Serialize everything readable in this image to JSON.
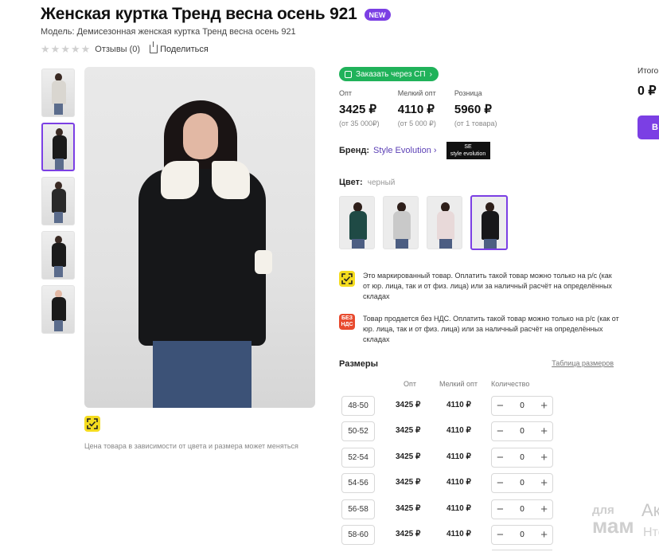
{
  "product": {
    "title": "Женская куртка Тренд весна осень 921",
    "badge": "NEW",
    "model": "Модель: Демисезонная женская куртка Тренд весна осень 921",
    "reviews": "Отзывы (0)",
    "share": "Поделиться",
    "rating_stars": 0,
    "rating_max": 5
  },
  "gallery": {
    "marked_note": "Цена товара в зависимости от цвета и размера может меняться"
  },
  "sp_button": "Заказать через СП",
  "prices": [
    {
      "label": "Опт",
      "value": "3425 ₽",
      "sub": "(от 35 000₽)"
    },
    {
      "label": "Мелкий опт",
      "value": "4110 ₽",
      "sub": "(от 5 000 ₽)"
    },
    {
      "label": "Розница",
      "value": "5960 ₽",
      "sub": "(от 1 товара)"
    }
  ],
  "brand": {
    "label": "Бренд:",
    "name": "Style Evolution",
    "logo_line1": "SE",
    "logo_line2": "style evolution"
  },
  "color": {
    "label": "Цвет:",
    "value": "черный",
    "swatch_colors": [
      "#1f4a45",
      "#c9c9c9",
      "#e8d9d9",
      "#17171a"
    ]
  },
  "notices": [
    {
      "icon": "marked-goods-icon",
      "text": "Это маркированный товар. Оплатить такой товар можно только на р/с (как от юр. лица, так и от физ. лица) или за наличный расчёт на определённых складах"
    },
    {
      "icon": "no-vat-icon",
      "icon_text1": "БЕЗ",
      "icon_text2": "НДС",
      "text": "Товар продается без НДС. Оплатить такой товар можно только на р/с (как от юр. лица, так и от физ. лица) или за наличный расчёт на определённых складах"
    }
  ],
  "sizes": {
    "title": "Размеры",
    "table_link": "Таблица размеров",
    "col_opt": "Опт",
    "col_small": "Мелкий опт",
    "col_qty": "Количество",
    "rows": [
      {
        "size": "48-50",
        "opt": "3425 ₽",
        "small": "4110 ₽",
        "qty": "0"
      },
      {
        "size": "50-52",
        "opt": "3425 ₽",
        "small": "4110 ₽",
        "qty": "0"
      },
      {
        "size": "52-54",
        "opt": "3425 ₽",
        "small": "4110 ₽",
        "qty": "0"
      },
      {
        "size": "54-56",
        "opt": "3425 ₽",
        "small": "4110 ₽",
        "qty": "0"
      },
      {
        "size": "56-58",
        "opt": "3425 ₽",
        "small": "4110 ₽",
        "qty": "0"
      },
      {
        "size": "58-60",
        "opt": "3425 ₽",
        "small": "4110 ₽",
        "qty": "0"
      }
    ],
    "minus": "−",
    "plus": "+"
  },
  "sidebar": {
    "total_label": "Итого",
    "total_value": "0 ₽",
    "button_label": "В"
  },
  "watermark": {
    "line1": "для",
    "line2": "мам",
    "side1": "Ак",
    "side2": "Нте"
  },
  "colors": {
    "accent": "#7b3fe4",
    "sp_green": "#20b25a",
    "marked_yellow": "#f5dc1f",
    "nds_red": "#e84a2e"
  }
}
